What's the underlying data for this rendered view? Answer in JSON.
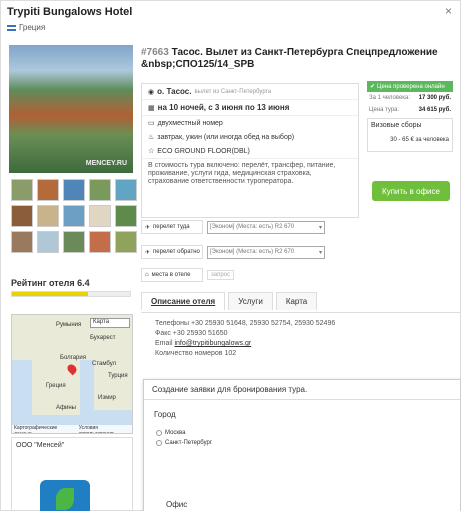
{
  "header": {
    "title": "Trypiti Bungalows Hotel",
    "country": "Греция",
    "close": "×"
  },
  "gallery": {
    "watermark": "MENCEY.RU",
    "thumbs": [
      "#8a9c6a",
      "#b56a3b",
      "#4f86b7",
      "#7a9a5b",
      "#62a5c3",
      "#8b5d3a",
      "#c9b38a",
      "#6d9fc4",
      "#e0d6c2",
      "#5e8a4c",
      "#9a7a5e",
      "#b0c7d8",
      "#6a8a5a",
      "#c46e49",
      "#8fa35c"
    ]
  },
  "rating": {
    "label": "Рейтинг отеля 6.4",
    "value": 0.64
  },
  "map": {
    "select": "Карта",
    "labels": [
      "Румыния",
      "Бухарест",
      "Болгария",
      "Турция",
      "Стамбул",
      "Греция",
      "Афины",
      "Измир"
    ],
    "footer": [
      "Картографические данные",
      "Условия использования"
    ]
  },
  "agency": {
    "name": "ООО \"Менсей\""
  },
  "tour": {
    "number": "#7663",
    "title": " Тасос. Вылет из Санкт-Петербурга Спецпредложение &nbsp;СПО125/14_SPB"
  },
  "info": {
    "place": "о. Тасос.",
    "departure": "вылет из Санкт-Петербурга",
    "dates": "на 10 ночей, с 3 июня по 13 июня",
    "room": "двухместный номер",
    "meals": "завтрак, ужин (или иногда обед на выбор)",
    "roomtype": "ECO GROUND FLOOR(DBL)",
    "included": "В стоимость тура включено: перелёт, трансфер, питание, проживание, услуги гида, медицинская страховка, страхование ответственности туроператора."
  },
  "price": {
    "badge": "Цена проверена онлайн",
    "per_person_label": "За 1 человека:",
    "per_person": "17 300 руб.",
    "total_label": "Цена тура:",
    "total": "34 615 руб.",
    "visa_label": "Визовые сборы",
    "visa": "30 - 65 € за человека",
    "buy": "Купить в офисе"
  },
  "flights": {
    "there_label": "перелет туда",
    "there": "[Эконом] (Места: есть) R2 670",
    "back_label": "перелет обратно",
    "back": "[Эконом] (Места: есть) R2 670",
    "hotel_label": "места в отеле",
    "hotel_status": "запрос"
  },
  "tabs": [
    "Описание отеля",
    "Услуги",
    "Карта"
  ],
  "contacts": {
    "phones": "Телефоны +30 25930 51648, 25930 52754, 25930 52496",
    "fax": "Факс +30 25930 51650",
    "email_label": "Email",
    "email": "info@trypitibungalows.gr",
    "rooms": "Количество номеров 102"
  },
  "form": {
    "title": "Создание заявки для бронирования тура.",
    "city": "Город",
    "options": [
      "Москва",
      "Санкт-Петербург"
    ],
    "office": "Офис"
  }
}
